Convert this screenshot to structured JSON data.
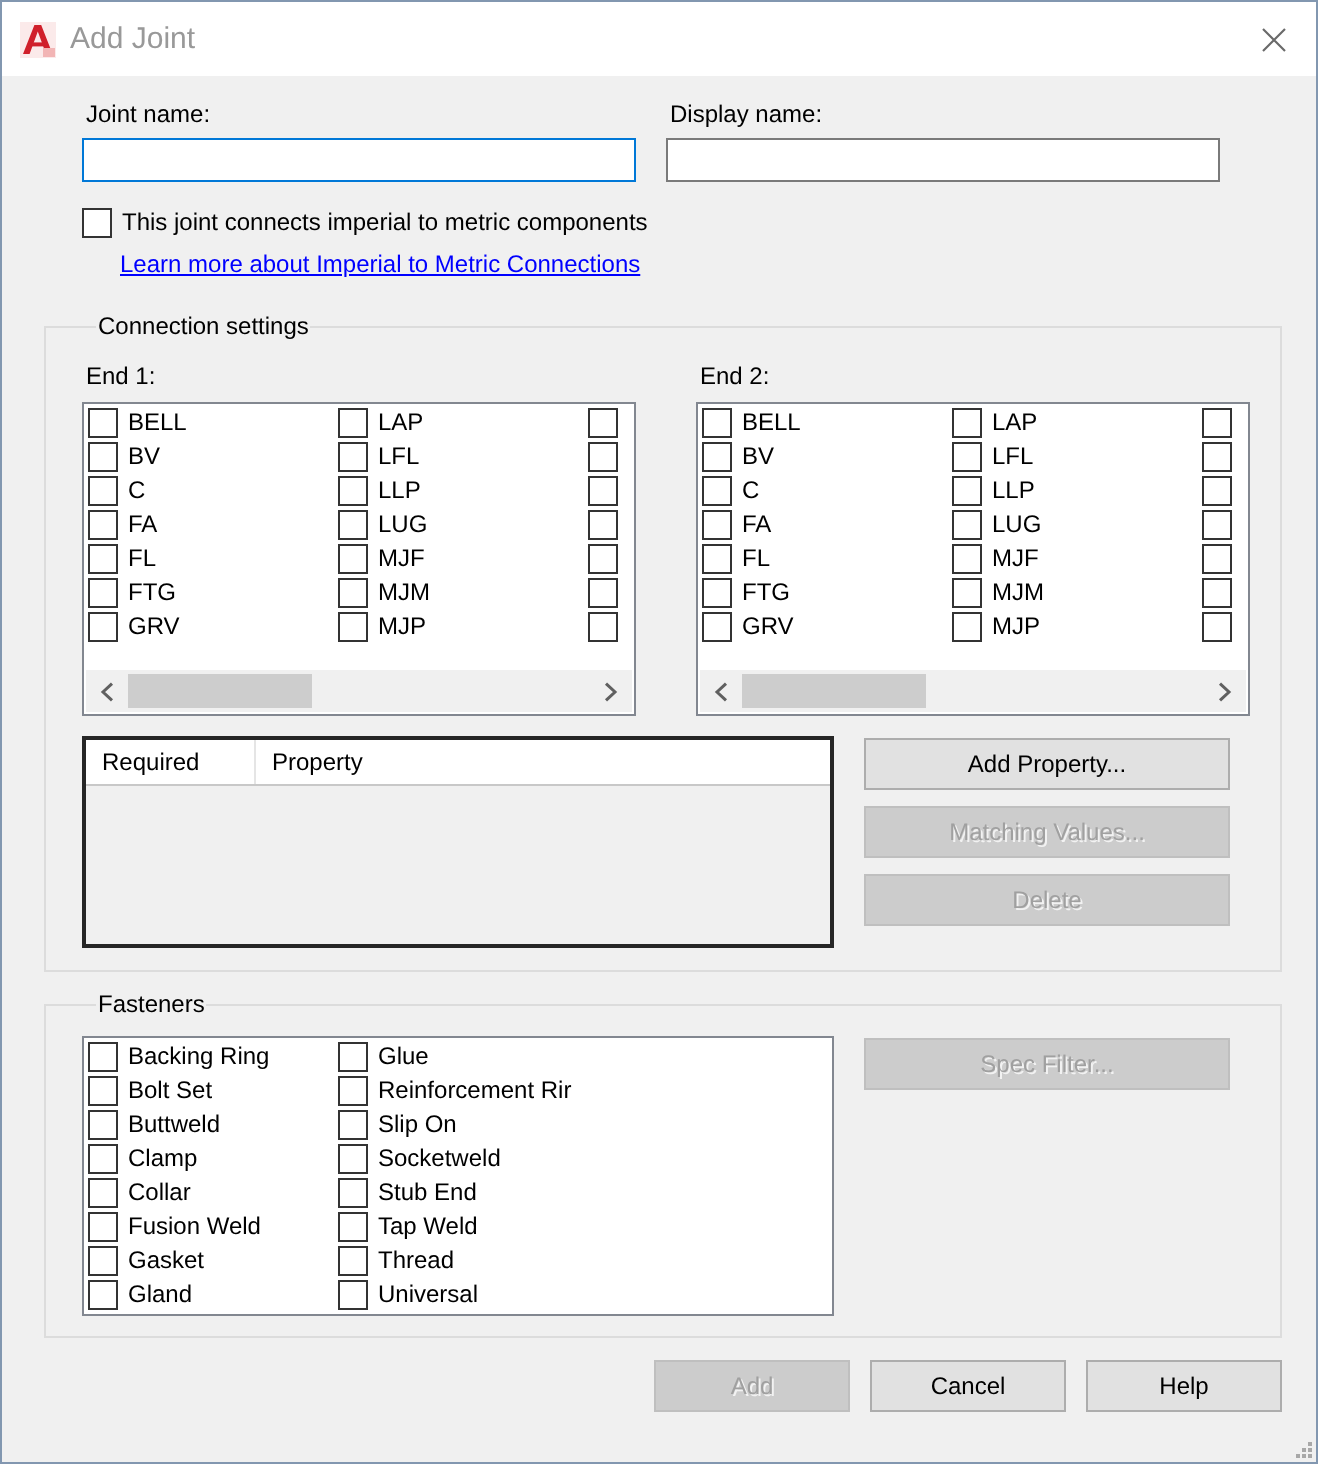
{
  "window": {
    "title": "Add Joint"
  },
  "name_fields": [
    {
      "label": "Joint name:",
      "focused": true
    },
    {
      "label": "Display name:",
      "focused": false
    }
  ],
  "imperial_to_metric": {
    "label": "This joint connects imperial to metric components",
    "checked": false
  },
  "learn_more_link": "Learn more about Imperial to Metric Connections",
  "connection_settings": {
    "title": "Connection settings",
    "ends": [
      {
        "label": "End 1:",
        "columns": [
          [
            {
              "label": "BELL",
              "checked": false
            },
            {
              "label": "BV",
              "checked": false
            },
            {
              "label": "C",
              "checked": false
            },
            {
              "label": "FA",
              "checked": false
            },
            {
              "label": "FL",
              "checked": false
            },
            {
              "label": "FTG",
              "checked": false
            },
            {
              "label": "GRV",
              "checked": false
            }
          ],
          [
            {
              "label": "LAP",
              "checked": false
            },
            {
              "label": "LFL",
              "checked": false
            },
            {
              "label": "LLP",
              "checked": false
            },
            {
              "label": "LUG",
              "checked": false
            },
            {
              "label": "MJF",
              "checked": false
            },
            {
              "label": "MJM",
              "checked": false
            },
            {
              "label": "MJP",
              "checked": false
            }
          ],
          [
            {
              "checked": false
            },
            {
              "checked": false
            },
            {
              "checked": false
            },
            {
              "checked": false
            },
            {
              "checked": false
            },
            {
              "checked": false
            },
            {
              "checked": false
            }
          ]
        ]
      },
      {
        "label": "End 2:",
        "columns": [
          [
            {
              "label": "BELL",
              "checked": false
            },
            {
              "label": "BV",
              "checked": false
            },
            {
              "label": "C",
              "checked": false
            },
            {
              "label": "FA",
              "checked": false
            },
            {
              "label": "FL",
              "checked": false
            },
            {
              "label": "FTG",
              "checked": false
            },
            {
              "label": "GRV",
              "checked": false
            }
          ],
          [
            {
              "label": "LAP",
              "checked": false
            },
            {
              "label": "LFL",
              "checked": false
            },
            {
              "label": "LLP",
              "checked": false
            },
            {
              "label": "LUG",
              "checked": false
            },
            {
              "label": "MJF",
              "checked": false
            },
            {
              "label": "MJM",
              "checked": false
            },
            {
              "label": "MJP",
              "checked": false
            }
          ],
          [
            {
              "checked": false
            },
            {
              "checked": false
            },
            {
              "checked": false
            },
            {
              "checked": false
            },
            {
              "checked": false
            },
            {
              "checked": false
            },
            {
              "checked": false
            }
          ]
        ]
      }
    ],
    "property_table": {
      "columns": [
        "Required",
        "Property"
      ]
    },
    "buttons": [
      {
        "label": "Add Property...",
        "disabled": false
      },
      {
        "label": "Matching Values...",
        "disabled": true
      },
      {
        "label": "Delete",
        "disabled": true
      }
    ]
  },
  "fasteners": {
    "title": "Fasteners",
    "columns": [
      [
        {
          "label": "Backing Ring",
          "checked": false
        },
        {
          "label": "Bolt Set",
          "checked": false
        },
        {
          "label": "Buttweld",
          "checked": false
        },
        {
          "label": "Clamp",
          "checked": false
        },
        {
          "label": "Collar",
          "checked": false
        },
        {
          "label": "Fusion Weld",
          "checked": false
        },
        {
          "label": "Gasket",
          "checked": false
        },
        {
          "label": "Gland",
          "checked": false
        }
      ],
      [
        {
          "label": "Glue",
          "checked": false
        },
        {
          "label": "Reinforcement Rir",
          "checked": false
        },
        {
          "label": "Slip On",
          "checked": false
        },
        {
          "label": "Socketweld",
          "checked": false
        },
        {
          "label": "Stub End",
          "checked": false
        },
        {
          "label": "Tap Weld",
          "checked": false
        },
        {
          "label": "Thread",
          "checked": false
        },
        {
          "label": "Universal",
          "checked": false
        }
      ]
    ],
    "buttons": [
      {
        "label": "Spec Filter...",
        "disabled": true
      }
    ]
  },
  "buttons": [
    {
      "label": "Add",
      "disabled": true
    },
    {
      "label": "Cancel",
      "disabled": false
    },
    {
      "label": "Help",
      "disabled": false
    }
  ]
}
